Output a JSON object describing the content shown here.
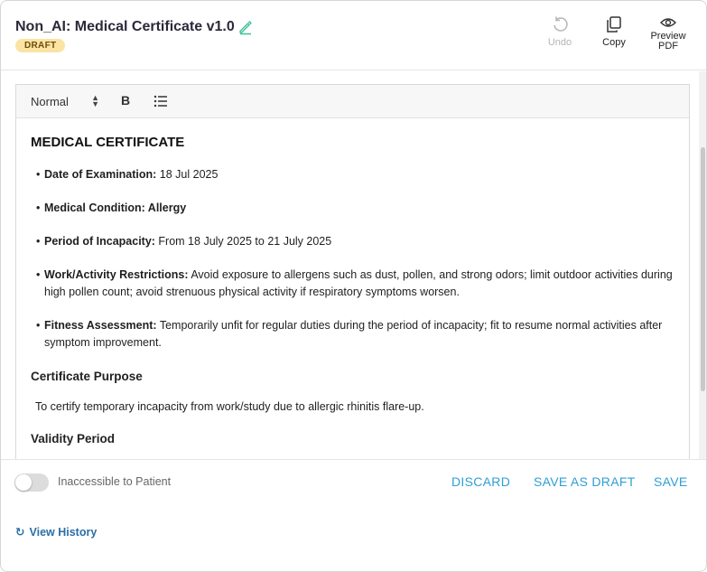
{
  "header": {
    "title": "Non_AI: Medical Certificate v1.0",
    "badge": "DRAFT",
    "tools": {
      "undo": "Undo",
      "copy": "Copy",
      "preview_line1": "Preview",
      "preview_line2": "PDF"
    }
  },
  "toolbar": {
    "style_select": "Normal",
    "bold": "B"
  },
  "document": {
    "heading": "MEDICAL CERTIFICATE",
    "items": [
      {
        "label": "Date of Examination:",
        "text": " 18 Jul 2025"
      },
      {
        "label": "Medical Condition: Allergy",
        "text": ""
      },
      {
        "label": "Period of Incapacity:",
        "text": " From 18 July 2025 to 21 July 2025"
      },
      {
        "label": "Work/Activity Restrictions:",
        "text": " Avoid exposure to allergens such as dust, pollen, and strong odors; limit outdoor activities during high pollen count; avoid strenuous physical activity if respiratory symptoms worsen."
      },
      {
        "label": "Fitness Assessment:",
        "text": " Temporarily unfit for regular duties during the period of incapacity; fit to resume normal activities after symptom improvement."
      }
    ],
    "purpose_heading": "Certificate Purpose",
    "purpose_text": "To certify temporary incapacity from work/study due to allergic rhinitis flare-up.",
    "validity_heading": "Validity Period"
  },
  "footer": {
    "toggle_label": "Inaccessible to Patient",
    "discard": "DISCARD",
    "save_draft": "SAVE AS DRAFT",
    "save": "SAVE",
    "history": "View History"
  },
  "colors": {
    "accent": "#2f9fd4",
    "edit_icon": "#3cc19a",
    "badge_bg": "#fbe3a3"
  },
  "icons": {
    "edit": "pencil-icon",
    "undo": "undo-icon",
    "copy": "copy-icon",
    "preview": "eye-icon",
    "list": "bullet-list-icon",
    "history": "refresh-icon"
  }
}
